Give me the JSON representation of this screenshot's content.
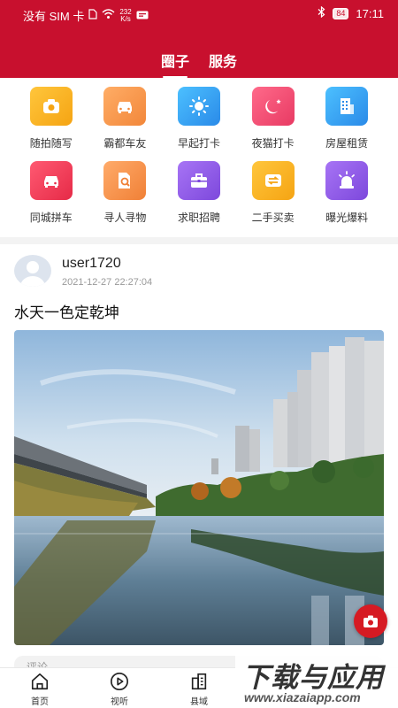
{
  "status_bar": {
    "carrier": "没有 SIM 卡",
    "net_speed_value": "232",
    "net_speed_unit": "K/s",
    "battery": "84",
    "time": "17:11"
  },
  "tabs": [
    {
      "label": "圈子",
      "active": true
    },
    {
      "label": "服务",
      "active": false
    }
  ],
  "categories": [
    {
      "label": "随拍随写",
      "icon": "camera-icon",
      "color": "#f7b52c"
    },
    {
      "label": "霸都车友",
      "icon": "car-icon",
      "color": "#f39a4e"
    },
    {
      "label": "早起打卡",
      "icon": "sun-icon",
      "color": "#3aa7ef"
    },
    {
      "label": "夜猫打卡",
      "icon": "moon-icon",
      "color": "#f25277"
    },
    {
      "label": "房屋租赁",
      "icon": "building-icon",
      "color": "#2fa6ef"
    },
    {
      "label": "同城拼车",
      "icon": "car-icon",
      "color": "#ef3a52"
    },
    {
      "label": "寻人寻物",
      "icon": "search-document-icon",
      "color": "#f5934a"
    },
    {
      "label": "求职招聘",
      "icon": "briefcase-icon",
      "color": "#8f58e6"
    },
    {
      "label": "二手买卖",
      "icon": "exchange-icon",
      "color": "#f7b52c"
    },
    {
      "label": "曝光爆料",
      "icon": "siren-icon",
      "color": "#8f58e6"
    }
  ],
  "post": {
    "username": "user1720",
    "timestamp": "2021-12-27 22:27:04",
    "text": "水天一色定乾坤"
  },
  "comment": {
    "placeholder": "评论"
  },
  "bottom_nav": [
    {
      "label": "首页",
      "icon": "home-icon"
    },
    {
      "label": "视听",
      "icon": "play-icon"
    },
    {
      "label": "县域",
      "icon": "city-icon"
    }
  ],
  "watermark": {
    "title": "下载与应用",
    "url": "www.xiazaiapp.com"
  },
  "colors": {
    "brand": "#c8102e",
    "fab": "#d61a23"
  }
}
